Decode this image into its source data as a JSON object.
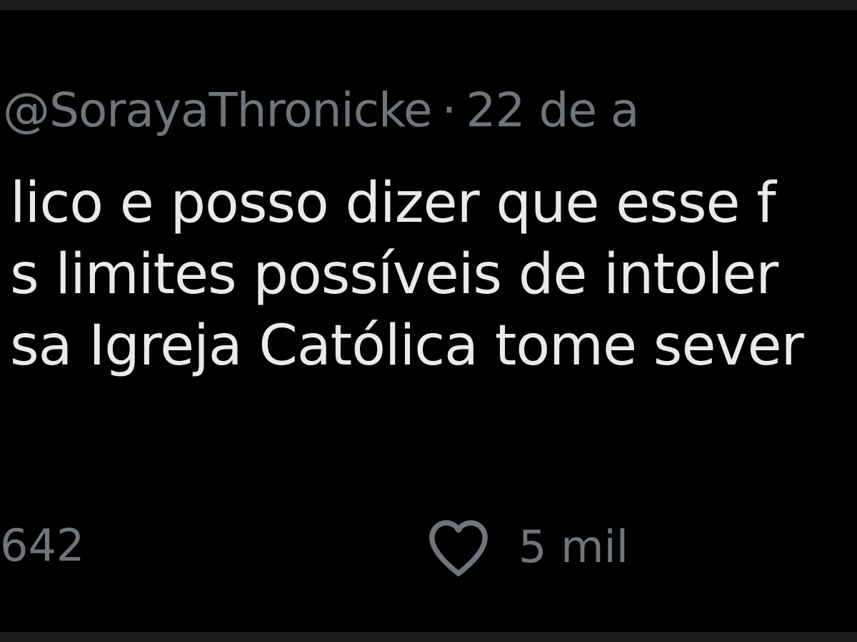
{
  "tweet": {
    "handle": "@SorayaThronicke",
    "separator": "·",
    "date": "22 de a",
    "body_lines": [
      "lico e posso dizer que esse f",
      "s limites possíveis de intoler",
      "sa Igreja Católica tome sever"
    ]
  },
  "actions": {
    "reply_count": "642",
    "like_icon": "heart-icon",
    "like_count": "5 mil"
  },
  "colors": {
    "background": "#000000",
    "border": "#1c1c1c",
    "text": "#e8eaeb",
    "muted": "#6f757b"
  }
}
